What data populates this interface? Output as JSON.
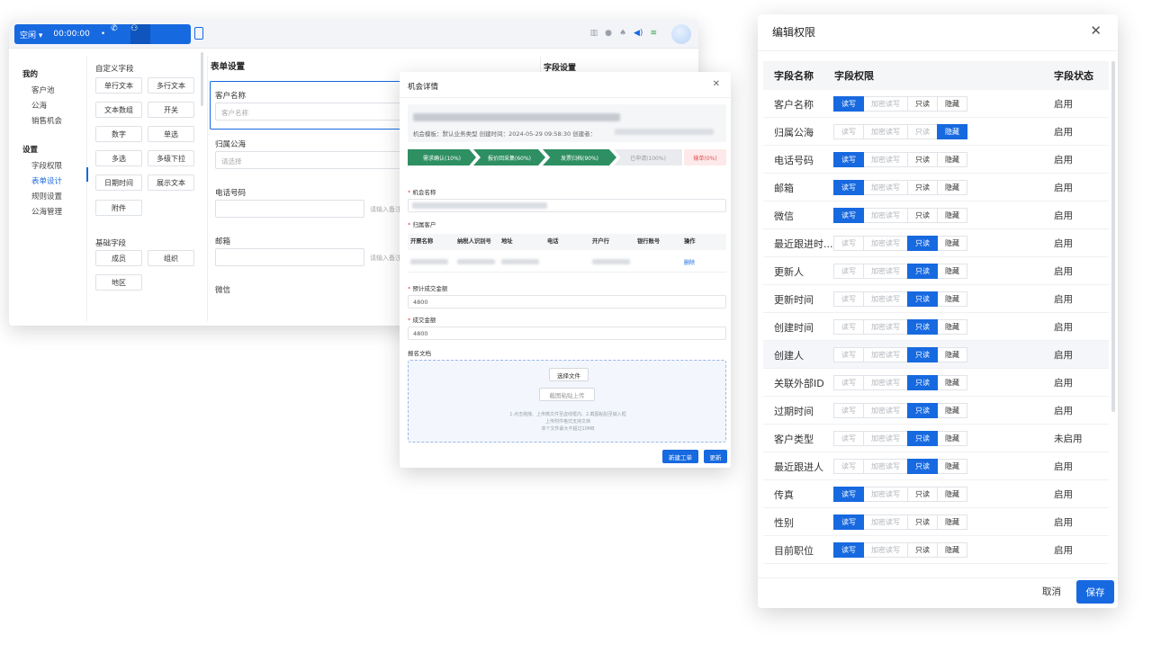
{
  "topbar": {
    "status": "空闲",
    "timer": "00:00:00"
  },
  "nav": {
    "group1": "我的",
    "group1_items": [
      "客户池",
      "公海",
      "销售机会"
    ],
    "group2": "设置",
    "group2_items": [
      "字段权限",
      "表单设计",
      "规则设置",
      "公海管理"
    ]
  },
  "palette": {
    "custom_title": "自定义字段",
    "custom_fields": [
      "单行文本",
      "多行文本",
      "文本数组",
      "开关",
      "数字",
      "单选",
      "多选",
      "多级下拉",
      "日期时间",
      "展示文本",
      "附件"
    ],
    "basic_title": "基础字段",
    "basic_fields": [
      "成员",
      "组织",
      "地区"
    ]
  },
  "form": {
    "title": "表单设置",
    "customer_name_label": "客户名称",
    "customer_name_placeholder": "客户名称",
    "pool_label": "归属公海",
    "pool_placeholder": "请选择",
    "phone_label": "电话号码",
    "phone_hint": "请输入备注",
    "email_label": "邮箱",
    "email_hint": "请输入备注",
    "wechat_label": "微信"
  },
  "field_panel": {
    "title": "字段设置"
  },
  "opportunity": {
    "title": "机会详情",
    "meta": "机会模板：默认业务类型  创建时间：2024-05-29 09:58:30  创建者：",
    "stages": [
      "需求确认(10%)",
      "报价回采集(60%)",
      "发票归档(90%)",
      "已申请(100%)",
      "输单(0%)"
    ],
    "name_label": "机会名称",
    "customer_label": "归属客户",
    "columns": [
      "开票名称",
      "纳税人识别号",
      "地址",
      "电话",
      "开户行",
      "银行账号",
      "操作"
    ],
    "row_action": "删除",
    "expected_label": "预计成交金额",
    "expected_value": "4800",
    "deal_label": "成交金额",
    "deal_value": "4800",
    "docs_label": "报名文档",
    "choose_file": "选择文件",
    "paste_upload": "截图粘贴上传",
    "upload_tips": [
      "1.点击拖拽、上传微文件至虚线框内、2.截图粘贴至输入框",
      "上传附件格式支持文档",
      "单个文件最大不超过10MB"
    ],
    "new_ticket": "新建工单",
    "update": "更新"
  },
  "permissions": {
    "title": "编辑权限",
    "col_name": "字段名称",
    "col_perm": "字段权限",
    "col_status": "字段状态",
    "options": [
      "读写",
      "加密读写",
      "只读",
      "隐藏"
    ],
    "rows": [
      {
        "name": "客户名称",
        "selected": "读写",
        "status": "启用"
      },
      {
        "name": "归属公海",
        "selected": "隐藏",
        "status": "启用"
      },
      {
        "name": "电话号码",
        "selected": "读写",
        "status": "启用"
      },
      {
        "name": "邮箱",
        "selected": "读写",
        "status": "启用"
      },
      {
        "name": "微信",
        "selected": "读写",
        "status": "启用"
      },
      {
        "name": "最近跟进时...",
        "selected": "只读",
        "status": "启用"
      },
      {
        "name": "更新人",
        "selected": "只读",
        "status": "启用"
      },
      {
        "name": "更新时间",
        "selected": "只读",
        "status": "启用"
      },
      {
        "name": "创建时间",
        "selected": "只读",
        "status": "启用"
      },
      {
        "name": "创建人",
        "selected": "只读",
        "status": "启用"
      },
      {
        "name": "关联外部ID",
        "selected": "只读",
        "status": "启用"
      },
      {
        "name": "过期时间",
        "selected": "只读",
        "status": "启用"
      },
      {
        "name": "客户类型",
        "selected": "只读",
        "status": "未启用"
      },
      {
        "name": "最近跟进人",
        "selected": "只读",
        "status": "启用"
      },
      {
        "name": "传真",
        "selected": "读写",
        "status": "启用"
      },
      {
        "name": "性别",
        "selected": "读写",
        "status": "启用"
      },
      {
        "name": "目前职位",
        "selected": "读写",
        "status": "启用"
      }
    ],
    "cancel": "取消",
    "save": "保存"
  },
  "colors": {
    "accent": "#1769e0",
    "stage_done": "#2e8f62",
    "lost": "#e05050"
  }
}
